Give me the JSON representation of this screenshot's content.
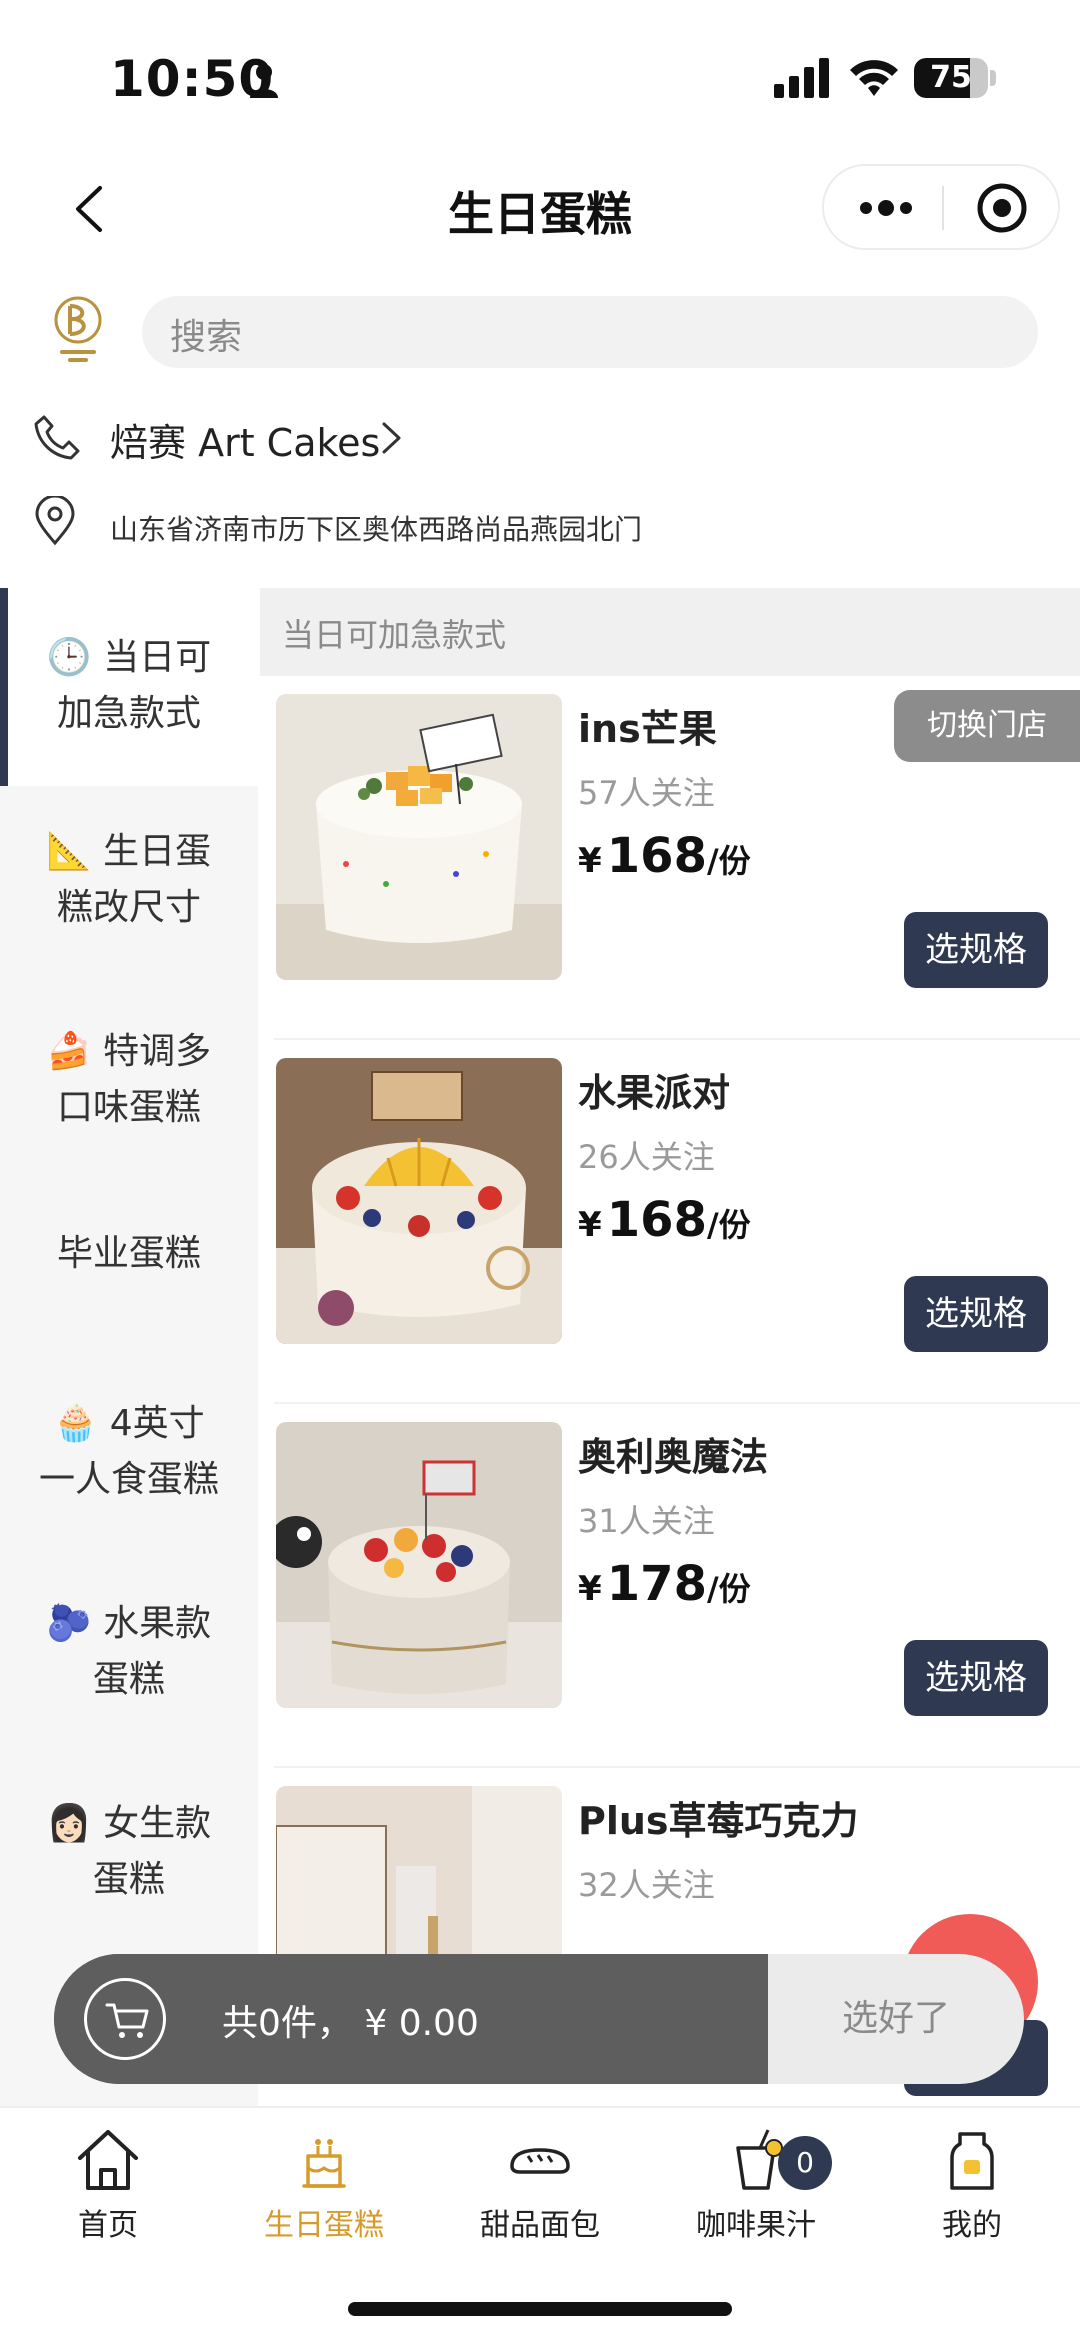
{
  "status_bar": {
    "time": "10:50",
    "battery": "75",
    "battery_level": 0.75
  },
  "navbar": {
    "title": "生日蛋糕"
  },
  "search": {
    "placeholder": "搜索"
  },
  "store": {
    "name": "焙赛 Art Cakes",
    "address": "山东省济南市历下区奥体西路尚品燕园北门"
  },
  "sidebar": {
    "items": [
      {
        "emoji": "🕒",
        "line1": "当日可",
        "line2": "加急款式",
        "active": true
      },
      {
        "emoji": "📐",
        "line1": "生日蛋",
        "line2": "糕改尺寸"
      },
      {
        "emoji": "🍰",
        "line1": "特调多",
        "line2": "口味蛋糕"
      },
      {
        "emoji": "",
        "line1": "毕业蛋糕",
        "line2": ""
      },
      {
        "emoji": "🧁",
        "line1": "4英寸",
        "line2": "一人食蛋糕"
      },
      {
        "emoji": "🫐",
        "line1": "水果款",
        "line2": "蛋糕"
      },
      {
        "emoji": "👩🏻",
        "line1": "女生款",
        "line2": "蛋糕"
      }
    ]
  },
  "section": {
    "title": "当日可加急款式"
  },
  "switch_store": "切换门店",
  "products": [
    {
      "name": "ins芒果",
      "follow": "57人关注",
      "currency": "¥",
      "price": "168",
      "unit": "/份",
      "button": "选规格"
    },
    {
      "name": "水果派对",
      "follow": "26人关注",
      "currency": "¥",
      "price": "168",
      "unit": "/份",
      "button": "选规格"
    },
    {
      "name": "奥利奥魔法",
      "follow": "31人关注",
      "currency": "¥",
      "price": "178",
      "unit": "/份",
      "button": "选规格"
    },
    {
      "name": "Plus草莓巧克力",
      "follow": "32人关注"
    }
  ],
  "cart": {
    "summary": "共0件，  ¥ 0.00",
    "done": "选好了"
  },
  "tabbar": {
    "items": [
      {
        "label": "首页",
        "icon": "home-icon"
      },
      {
        "label": "生日蛋糕",
        "icon": "cake-icon",
        "active": true
      },
      {
        "label": "甜品面包",
        "icon": "bread-icon"
      },
      {
        "label": "咖啡果汁",
        "icon": "drink-icon",
        "badge": "0"
      },
      {
        "label": "我的",
        "icon": "profile-icon"
      }
    ]
  },
  "colors": {
    "accent": "#2f3a52",
    "tab_active": "#d79b2c",
    "float_button": "#f05b57"
  }
}
